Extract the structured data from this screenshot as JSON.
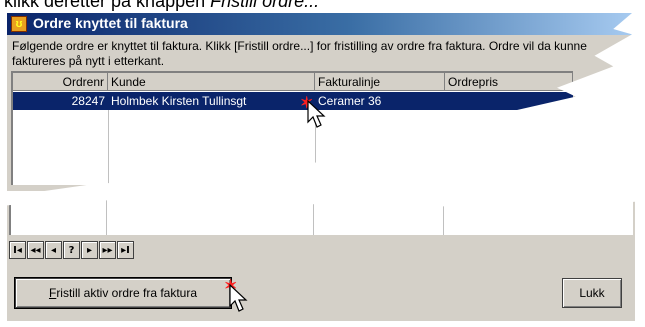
{
  "caption": {
    "before": "klikk deretter på knappen ",
    "emph": "Fristill ordre..."
  },
  "window": {
    "title": "Ordre knyttet til faktura",
    "icon": "app-icon",
    "info": "Følgende ordre er knyttet til faktura. Klikk [Fristill ordre...] for fristilling av ordre fra faktura. Ordre vil da kunne faktureres på nytt i etterkant."
  },
  "grid": {
    "columns": [
      "Ordrenr",
      "Kunde",
      "Fakturalinje",
      "Ordrepris"
    ],
    "selected_row": {
      "ordrenr": "28247",
      "kunde": "Holmbek Kirsten Tullinsgt",
      "fakturalinje": "Ceramer 36",
      "ordrepris": ""
    }
  },
  "navigator": {
    "buttons": [
      "first",
      "prior",
      "previous",
      "help",
      "next",
      "next-page",
      "last"
    ],
    "glyphs": [
      "I◂",
      "◂◂",
      "◂",
      "?",
      "▸",
      "▸▸",
      "▸I"
    ]
  },
  "buttons": {
    "release_hotkey": "F",
    "release_label_rest": "ristill aktiv ordre fra faktura",
    "close_label": "Lukk"
  },
  "colors": {
    "titlebar": "#0a246a",
    "selection": "#0a246a",
    "face": "#d4d0c8",
    "highlight_mark": "#ff2020"
  }
}
